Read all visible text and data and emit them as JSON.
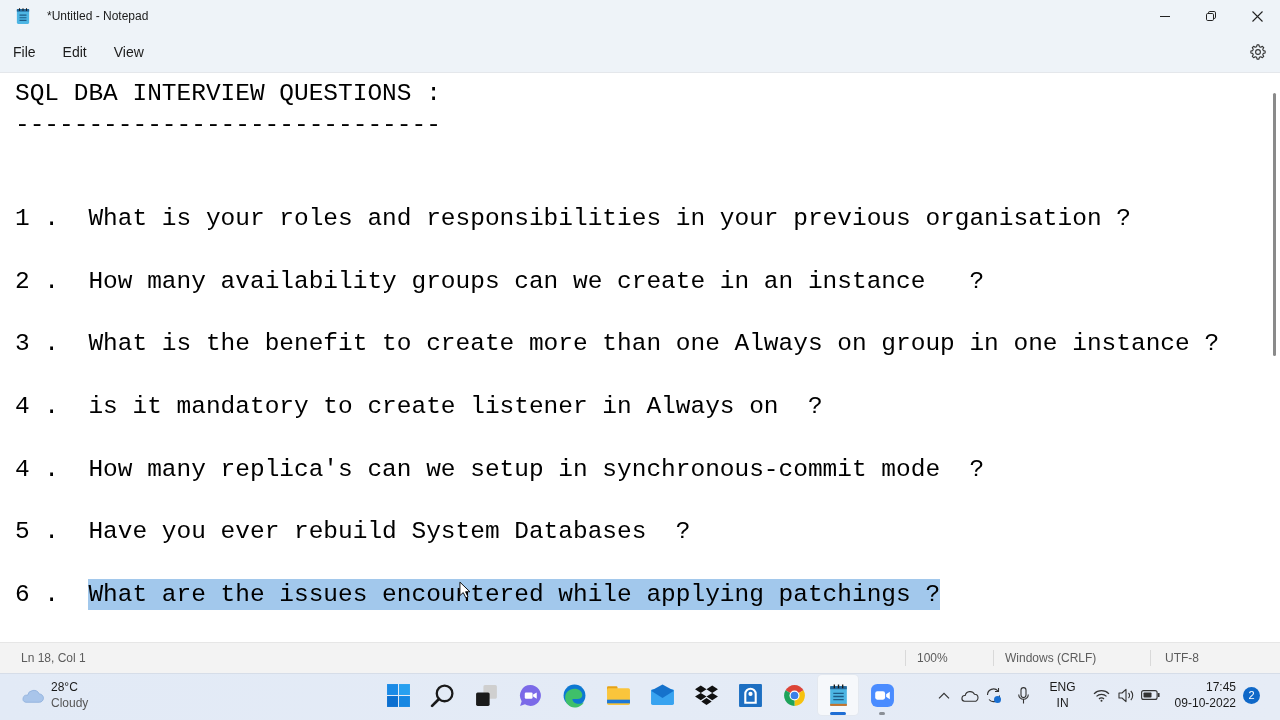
{
  "window": {
    "title": "*Untitled - Notepad"
  },
  "menu": [
    "File",
    "Edit",
    "View"
  ],
  "document": {
    "heading": "SQL DBA INTERVIEW QUESTIONS :",
    "underline": "-----------------------------",
    "questions": [
      {
        "number": "1 .",
        "text": "What is your roles and responsibilities in your previous organisation ?",
        "selected": false
      },
      {
        "number": "2 .",
        "text": "How many availability groups can we create in an instance   ?",
        "selected": false
      },
      {
        "number": "3 .",
        "text": "What is the benefit to create more than one Always on group in one instance ?",
        "selected": false
      },
      {
        "number": "4 .",
        "text": "is it mandatory to create listener in Always on  ?",
        "selected": false
      },
      {
        "number": "4 .",
        "text": "How many replica's can we setup in synchronous-commit mode  ?",
        "selected": false
      },
      {
        "number": "5 .",
        "text": "Have you ever rebuild System Databases  ?",
        "selected": false
      },
      {
        "number": "6 .",
        "text": "What are the issues encountered while applying patchings ?",
        "selected": true
      }
    ]
  },
  "status_bar": {
    "position": "Ln 18, Col 1",
    "zoom": "100%",
    "line_ending": "Windows (CRLF)",
    "encoding": "UTF-8"
  },
  "taskbar": {
    "weather": {
      "temperature": "28°C",
      "condition": "Cloudy"
    },
    "apps": [
      {
        "kind": "windows",
        "selected": false,
        "running": false
      },
      {
        "kind": "search",
        "selected": false,
        "running": false
      },
      {
        "kind": "taskview",
        "selected": false,
        "running": false
      },
      {
        "kind": "chat",
        "selected": false,
        "running": false
      },
      {
        "kind": "swirl",
        "selected": false,
        "running": false
      },
      {
        "kind": "folder",
        "selected": false,
        "running": false
      },
      {
        "kind": "mail",
        "selected": false,
        "running": false
      },
      {
        "kind": "boxes",
        "selected": false,
        "running": false
      },
      {
        "kind": "tile",
        "selected": false,
        "running": false
      },
      {
        "kind": "wheel",
        "selected": false,
        "running": false
      },
      {
        "kind": "notepad",
        "selected": true,
        "running": true
      },
      {
        "kind": "camera",
        "selected": false,
        "running": true
      }
    ],
    "language": {
      "line_1": "ENG",
      "line_2": "IN"
    },
    "clock": {
      "time": "17:45",
      "date": "09-10-2022"
    },
    "notification_count": "2"
  }
}
